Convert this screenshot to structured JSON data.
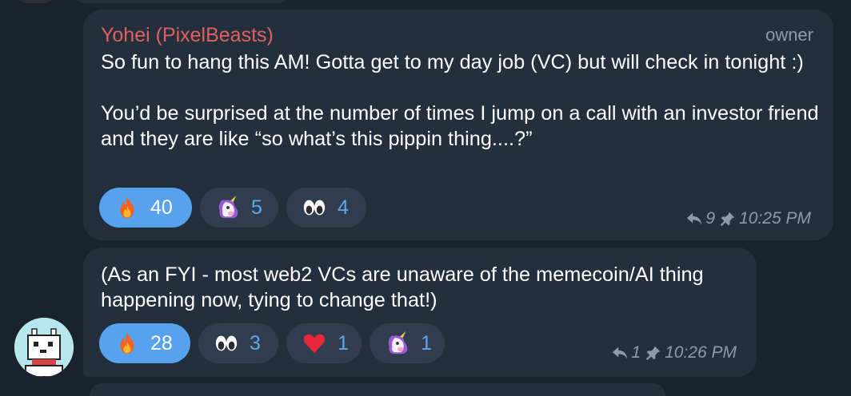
{
  "messages": [
    {
      "sender": "Yohei (PixelBeasts)",
      "role": "owner",
      "text": "So fun to hang this AM! Gotta get to my day job (VC) but will check in tonight :)\n\nYou’d be surprised at the number of times I jump on a call with an investor friend and they are like “so what’s this pippin thing....?”",
      "reactions": [
        {
          "emoji": "fire-icon",
          "count": "40",
          "active": true
        },
        {
          "emoji": "unicorn-icon",
          "count": "5",
          "active": false
        },
        {
          "emoji": "eyes-icon",
          "count": "4",
          "active": false
        }
      ],
      "replies": "9",
      "time": "10:25 PM"
    },
    {
      "text": "(As an FYI - most web2 VCs are unaware of the memecoin/AI thing happening now, tying to change that!)",
      "reactions": [
        {
          "emoji": "fire-icon",
          "count": "28",
          "active": true
        },
        {
          "emoji": "eyes-icon",
          "count": "3",
          "active": false
        },
        {
          "emoji": "heart-icon",
          "count": "1",
          "active": false
        },
        {
          "emoji": "unicorn-icon",
          "count": "1",
          "active": false
        }
      ],
      "replies": "1",
      "time": "10:26 PM"
    }
  ],
  "colors": {
    "background": "#1a222e",
    "bubble": "#232f3d",
    "sender": "#e0605f",
    "accent": "#56a2ec",
    "meta": "#8f9aa8"
  }
}
